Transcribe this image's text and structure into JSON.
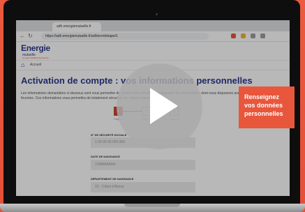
{
  "browser": {
    "tab_label": "adh.energiemutuelle.fr",
    "url": "https://adh.energiemutuelle.fr/adherent/etape/1",
    "back_icon": "arrow-left-icon",
    "reload_icon": "reload-icon",
    "lock_icon": "lock-icon"
  },
  "app": {
    "logo_main": "Energie",
    "logo_sub": "mutuelle",
    "logo_tag": "Groupe Solidarité Entreprise"
  },
  "breadcrumb": {
    "home_label": "Accueil"
  },
  "page": {
    "title": "Activation de compte : vos informations personnelles",
    "description": "Les informations demandées ci-dessous sont vous permettre de vérifier votre identité en comparant les informations dont nous disposons avec celles que vous nous avez fournies. Ces informations vous permettra de totalement sécuriser les étapes suivantes."
  },
  "steps": [
    {
      "number": "1",
      "label": "Etape 1",
      "active": true
    },
    {
      "number": "2",
      "label": "Etape 2",
      "active": false
    },
    {
      "number": "3",
      "label": "Etape 3",
      "active": false
    }
  ],
  "form": {
    "field1_label": "N° DE SÉCURITÉ SOCIALE",
    "field1_value": "1 00 00 00 000 000",
    "field2_label": "DATE DE NAISSANCE",
    "field2_value": "JJ/MM/AAAA",
    "field3_label": "DÉPARTEMENT DE NAISSANCE",
    "field3_value": "22 - Côtes-d'Armor"
  },
  "callout": {
    "line1": "Renseignez",
    "line2": "vos données",
    "line3": "personnelles"
  },
  "video": {
    "play_icon": "play-icon"
  },
  "colors": {
    "accent": "#e8563c",
    "brand": "#2b3a8f"
  }
}
